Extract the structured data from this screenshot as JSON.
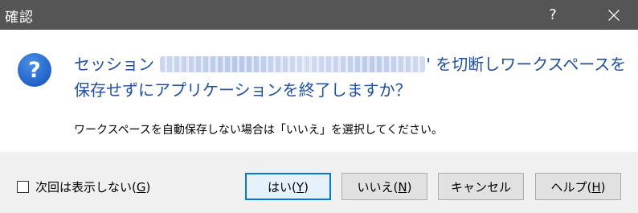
{
  "window": {
    "title": "確認",
    "help_glyph": "?",
    "colors": {
      "titlebar": "#555555",
      "accent": "#0078d7",
      "instruction_text": "#1e4fa8"
    }
  },
  "content": {
    "icon": "question-icon",
    "main_prefix": "セッション ",
    "main_suffix": "' を切断しワークスペースを保存せずにアプリケーションを終了しますか？",
    "sub": "ワークスペースを自動保存しない場合は「いいえ」を選択してください。"
  },
  "footer": {
    "checkbox_label": "次回は表示しない(",
    "checkbox_accel": "G",
    "checkbox_checked": false,
    "buttons": {
      "yes": {
        "label": "はい(",
        "accel": "Y"
      },
      "no": {
        "label": "いいえ(",
        "accel": "N"
      },
      "cancel": {
        "label": "キャンセル"
      },
      "help": {
        "label": "ヘルプ(",
        "accel": "H"
      }
    }
  }
}
